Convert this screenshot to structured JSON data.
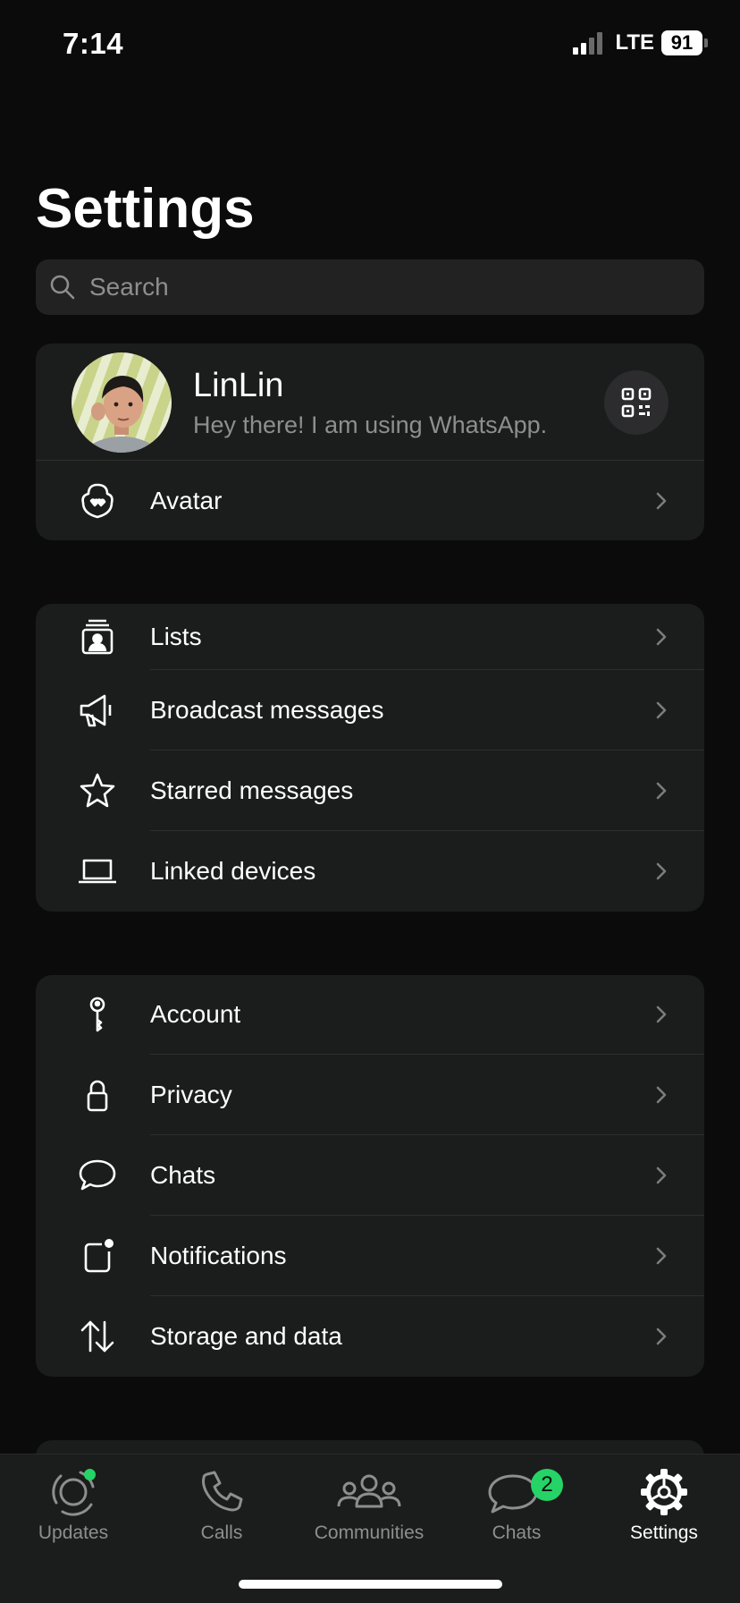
{
  "status_bar": {
    "time": "7:14",
    "network": "LTE",
    "battery": "91"
  },
  "page": {
    "title": "Settings"
  },
  "search": {
    "placeholder": "Search"
  },
  "profile": {
    "name": "LinLin",
    "status": "Hey there! I am using WhatsApp.",
    "qr_icon": "qr-code-icon"
  },
  "section_profile": {
    "avatar_label": "Avatar"
  },
  "section_tools": {
    "items": [
      {
        "label": "Lists",
        "icon": "lists-icon"
      },
      {
        "label": "Broadcast messages",
        "icon": "megaphone-icon"
      },
      {
        "label": "Starred messages",
        "icon": "star-icon"
      },
      {
        "label": "Linked devices",
        "icon": "laptop-icon"
      }
    ]
  },
  "section_settings": {
    "items": [
      {
        "label": "Account",
        "icon": "key-icon"
      },
      {
        "label": "Privacy",
        "icon": "lock-icon"
      },
      {
        "label": "Chats",
        "icon": "chat-bubble-icon"
      },
      {
        "label": "Notifications",
        "icon": "notification-icon"
      },
      {
        "label": "Storage and data",
        "icon": "arrows-updown-icon"
      }
    ]
  },
  "tab_bar": {
    "tabs": [
      {
        "label": "Updates",
        "icon": "updates-icon"
      },
      {
        "label": "Calls",
        "icon": "phone-icon"
      },
      {
        "label": "Communities",
        "icon": "communities-icon"
      },
      {
        "label": "Chats",
        "icon": "chats-icon",
        "badge": "2"
      },
      {
        "label": "Settings",
        "icon": "settings-gear-icon",
        "active": true
      }
    ]
  },
  "colors": {
    "accent": "#25d366",
    "background": "#0b0b0b",
    "card": "#1b1c1c",
    "secondary_text": "#8e8e8e"
  }
}
